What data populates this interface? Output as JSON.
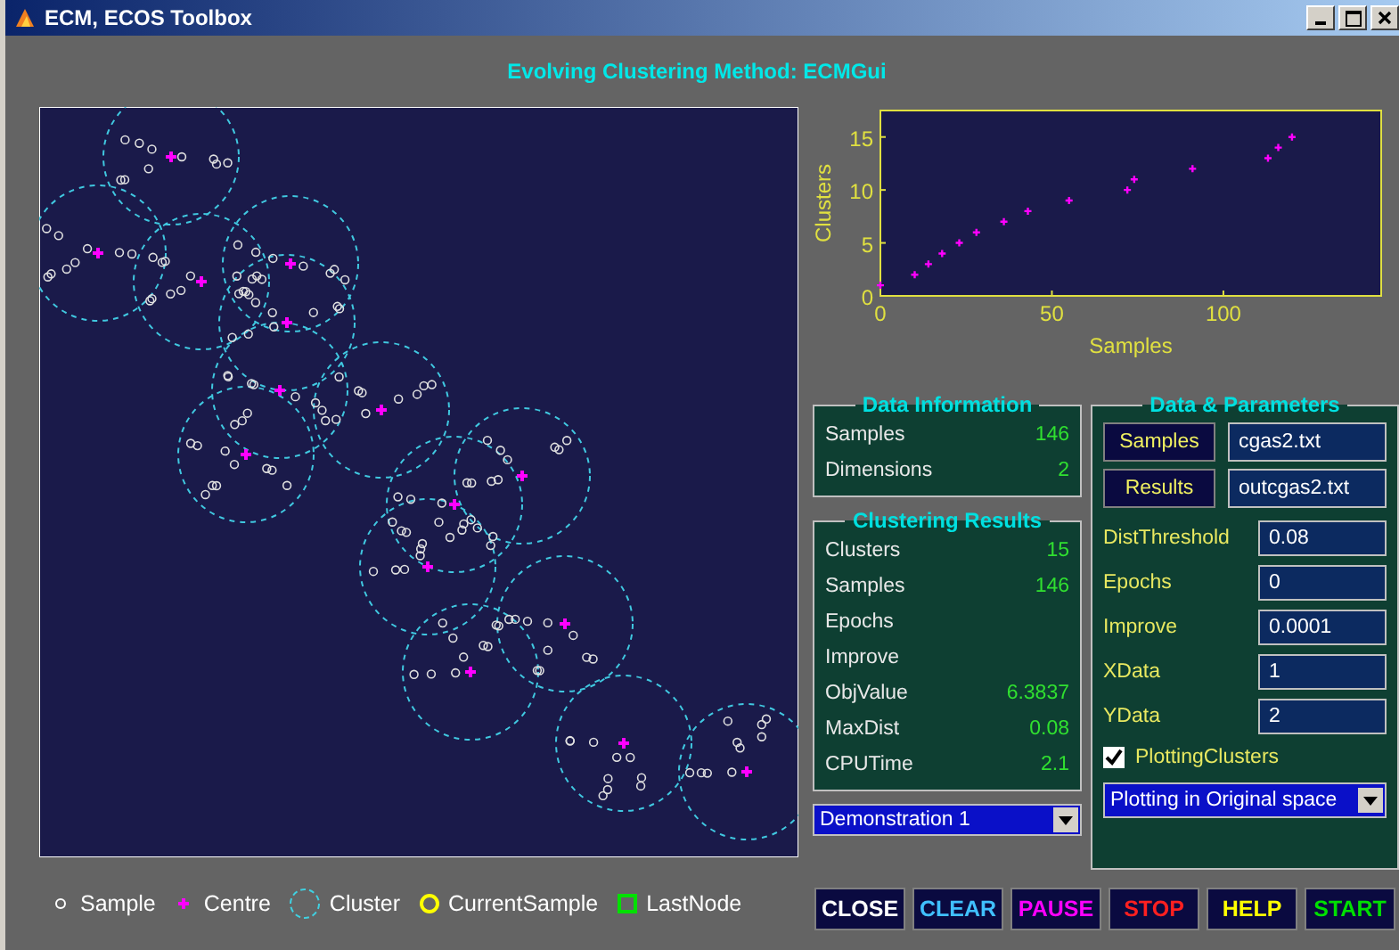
{
  "window": {
    "title": "ECM,  ECOS Toolbox"
  },
  "subtitle": "Evolving Clustering Method: ECMGui",
  "chart": {
    "chart_data": {
      "type": "scatter",
      "xlabel": "Samples",
      "ylabel": "Clusters",
      "x": [
        0,
        10,
        14,
        18,
        23,
        28,
        36,
        43,
        55,
        72,
        74,
        91,
        113,
        116,
        120
      ],
      "series": [
        {
          "color": "#ff00ff",
          "values": [
            1,
            2,
            3,
            4,
            5,
            6,
            7,
            8,
            9,
            10,
            11,
            12,
            13,
            14,
            15
          ]
        }
      ],
      "xlim": [
        0,
        146
      ],
      "ylim": [
        0,
        17.5
      ],
      "xticks": [
        0,
        50,
        100
      ],
      "yticks": [
        0,
        5,
        10,
        15
      ]
    }
  },
  "data_information": {
    "title": "Data Information",
    "rows": [
      {
        "label": "Samples",
        "value": "146"
      },
      {
        "label": "Dimensions",
        "value": "2"
      }
    ]
  },
  "clustering_results": {
    "title": "Clustering Results",
    "rows": [
      {
        "label": "Clusters",
        "value": "15"
      },
      {
        "label": "Samples",
        "value": "146"
      },
      {
        "label": "Epochs"
      },
      {
        "label": "Improve"
      },
      {
        "label": "ObjValue",
        "value": "6.3837"
      },
      {
        "label": "MaxDist",
        "value": "0.08"
      },
      {
        "label": "CPUTime",
        "value": "2.1"
      }
    ]
  },
  "demo_dropdown": {
    "value": "Demonstration 1"
  },
  "data_parameters": {
    "title": "Data & Parameters",
    "files": [
      {
        "button": "Samples",
        "value": "cgas2.txt"
      },
      {
        "button": "Results",
        "value": "outcgas2.txt"
      }
    ],
    "params": [
      {
        "label": "DistThreshold",
        "value": "0.08"
      },
      {
        "label": "Epochs",
        "value": "0"
      },
      {
        "label": "Improve",
        "value": "0.0001"
      },
      {
        "label": "XData",
        "value": "1"
      },
      {
        "label": "YData",
        "value": "2"
      }
    ],
    "plotting_clusters": {
      "label": "PlottingClusters",
      "checked": true
    },
    "plot_dropdown": {
      "value": "Plotting in Original space"
    }
  },
  "legend": [
    {
      "kind": "dot",
      "label": "Sample",
      "color": "#ffffff"
    },
    {
      "kind": "plus",
      "label": "Centre",
      "color": "#ff00ff"
    },
    {
      "kind": "ring",
      "label": "Cluster",
      "color": "#40d0e0"
    },
    {
      "kind": "circle",
      "label": "CurrentSample",
      "color": "#ffff00"
    },
    {
      "kind": "square",
      "label": "LastNode",
      "color": "#00e000"
    }
  ],
  "buttons": [
    {
      "label": "CLOSE",
      "kind": "close"
    },
    {
      "label": "CLEAR",
      "kind": "clear"
    },
    {
      "label": "PAUSE",
      "kind": "pause"
    },
    {
      "label": "STOP",
      "kind": "stop"
    },
    {
      "label": "HELP",
      "kind": "help"
    },
    {
      "label": "START",
      "kind": "start"
    }
  ]
}
